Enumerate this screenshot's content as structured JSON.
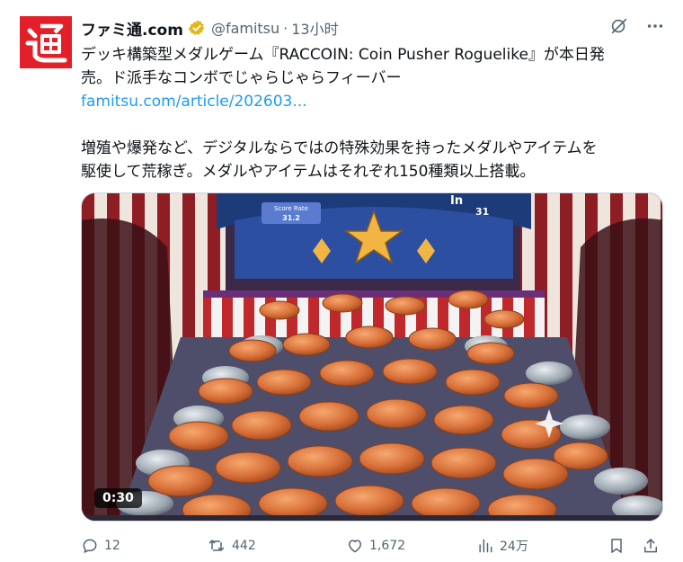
{
  "author": {
    "display_name": "ファミ通.com",
    "handle": "@famitsu",
    "separator": "·",
    "time": "13小时",
    "avatar_glyph": "通"
  },
  "post": {
    "line1": "デッキ構築型メダルゲーム『RACCOIN: Coin Pusher Roguelike』が本日発",
    "line2": "売。ド派手なコンボでじゃらじゃらフィーバー",
    "link": "famitsu.com/article/202603...",
    "line3": "増殖や爆発など、デジタルならではの特殊効果を持ったメダルやアイテムを",
    "line4": "駆使して荒稼ぎ。メダルやアイテムはそれぞれ150種類以上搭載。"
  },
  "media": {
    "duration": "0:30",
    "scene_labels": {
      "score_rate": "Score Rate",
      "score_rate_value": "31.2",
      "in_label": "In",
      "in_value": "31"
    }
  },
  "actions": {
    "replies": "12",
    "reposts": "442",
    "likes": "1,672",
    "views": "24万"
  },
  "icons": [
    "verified-badge-icon",
    "grok-icon",
    "more-icon",
    "reply-icon",
    "repost-icon",
    "like-icon",
    "views-icon",
    "bookmark-icon",
    "share-icon"
  ],
  "colors": {
    "brand_red": "#e3202a",
    "link_blue": "#1d9bf0",
    "verified_gold": "#e2b719",
    "muted": "#536471"
  }
}
